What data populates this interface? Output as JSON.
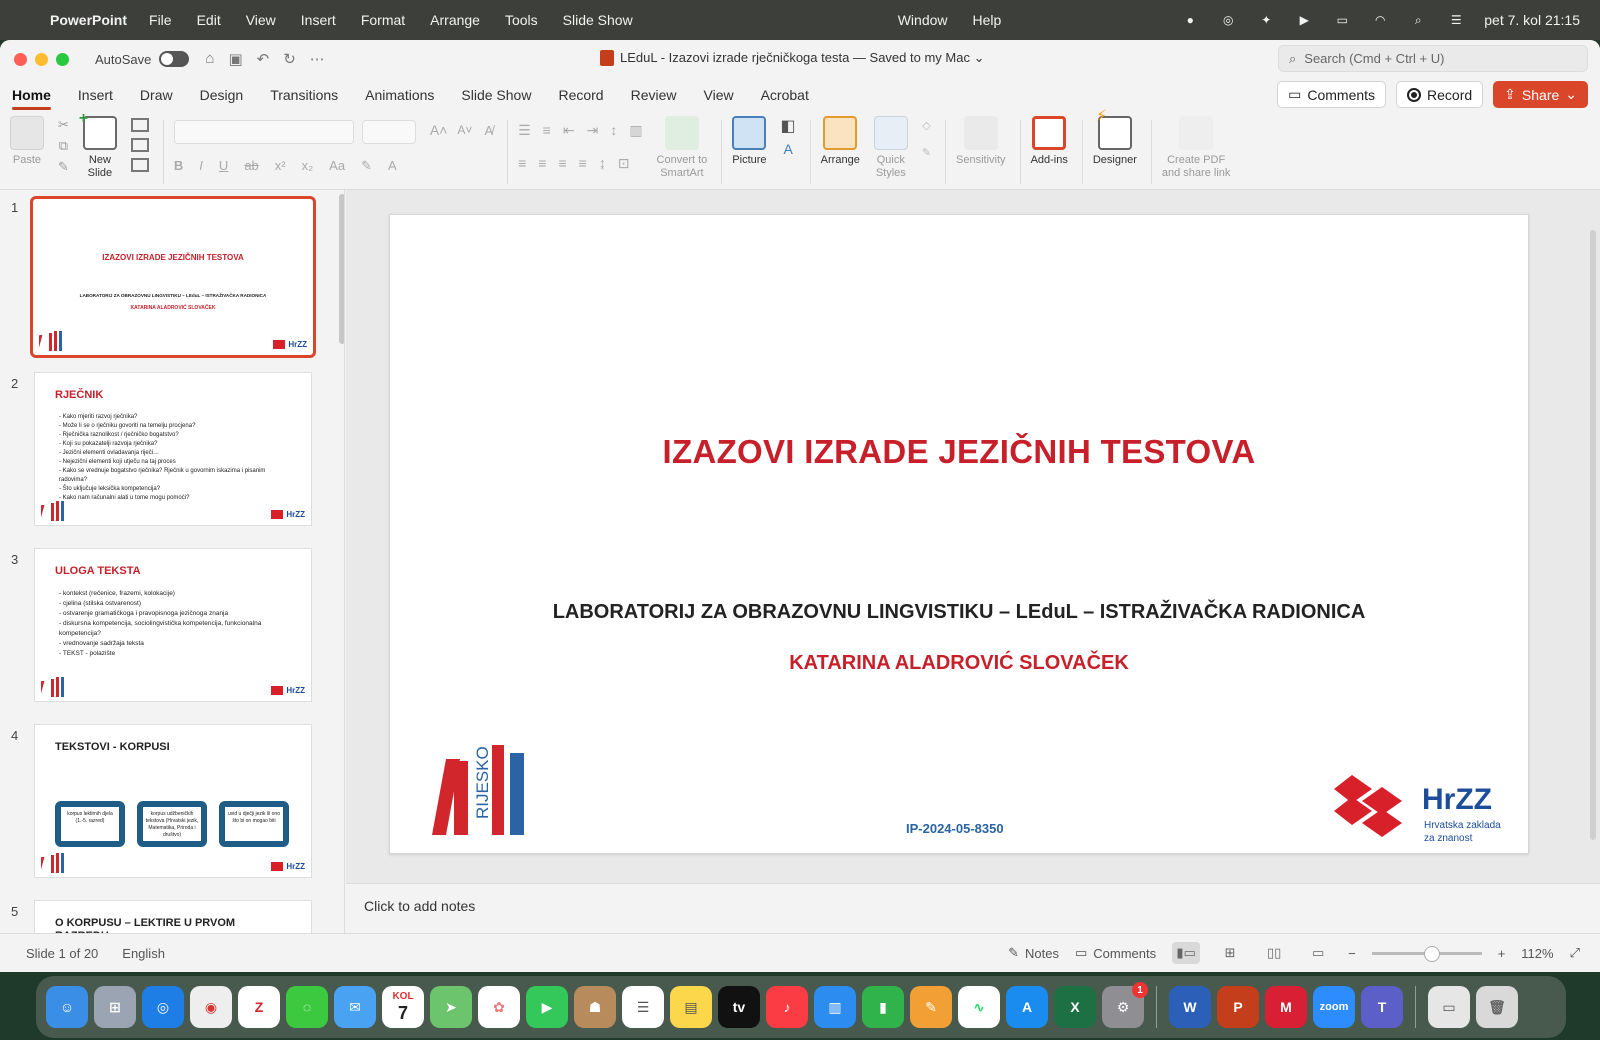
{
  "menubar": {
    "app_name": "PowerPoint",
    "items": [
      "File",
      "Edit",
      "View",
      "Insert",
      "Format",
      "Arrange",
      "Tools",
      "Slide Show"
    ],
    "items_mid": [
      "Window",
      "Help"
    ],
    "clock": "pet 7. kol  21:15"
  },
  "window": {
    "autosave_label": "AutoSave",
    "doc_title": "LEduL - Izazovi izrade rječničkoga testa — Saved to my Mac ⌄",
    "search_placeholder": "Search (Cmd + Ctrl + U)"
  },
  "tabs": [
    "Home",
    "Insert",
    "Draw",
    "Design",
    "Transitions",
    "Animations",
    "Slide Show",
    "Record",
    "Review",
    "View",
    "Acrobat"
  ],
  "tab_actions": {
    "comments": "Comments",
    "record": "Record",
    "share": "Share"
  },
  "ribbon": {
    "paste": "Paste",
    "new_slide_1": "New",
    "new_slide_2": "Slide",
    "convert_1": "Convert to",
    "convert_2": "SmartArt",
    "picture": "Picture",
    "arrange": "Arrange",
    "quick_styles_1": "Quick",
    "quick_styles_2": "Styles",
    "sensitivity": "Sensitivity",
    "addins": "Add-ins",
    "designer": "Designer",
    "pdf_1": "Create PDF",
    "pdf_2": "and share link"
  },
  "thumbnails": [
    {
      "num": "1",
      "title": "IZAZOVI IZRADE JEZIČNIH TESTOVA",
      "sub": "LABORATORIJ ZA OBRAZOVNU LINGVISTIKU – LEduL – ISTRAŽIVAČKA RADIONICA",
      "author": "KATARINA ALADROVIĆ SLOVAČEK"
    },
    {
      "num": "2",
      "title": "RJEČNIK",
      "bullets": [
        "Kako mjeriti razvoj rječnika?",
        "Može li se o rječniku govoriti na temelju procjena?",
        "Rječnička raznolikost / rječničko bogatstvo?",
        "Koji su pokazatelji razvoja rječnika?",
        "Jezični elementi ovladavanja riječi…",
        "Nejezični elementi koji utječu na taj proces",
        "Kako se vrednuje bogatstvo rječnika? Rječnik u govornim iskazima i pisanim radovima?",
        "Što uključuje leksička kompetencija?",
        "Kako nam računalni alati u tome mogu pomoći?"
      ]
    },
    {
      "num": "3",
      "title": "ULOGA TEKSTA",
      "bullets": [
        "kontekst (rečenice, frazemi, kolokacije)",
        "cjelina (stilska ostvarenost)",
        "ostvarenje gramatičkoga i pravopisnoga jezičnoga znanja",
        "diskursna kompetencija, sociolingvistička kompetencija, funkcionalna kompetencija?",
        "vrednovanje sadržaja teksta",
        "TEKST - polazište"
      ]
    },
    {
      "num": "4",
      "title": "TEKSTOVI - KORPUSI",
      "boxes": [
        "korpus lektirnih djela (1.-5. razred)",
        "korpus udžbeničkih tekstova (Hrvatski jezik, Matematika, Priroda i društvo)",
        "uvid u dječji jezik ili ono što bi on mogao biti"
      ]
    },
    {
      "num": "5",
      "title": "O KORPUSU – LEKTIRE U PRVOM RAZREDU"
    }
  ],
  "slide": {
    "title": "IZAZOVI IZRADE JEZIČNIH TESTOVA",
    "subtitle": "LABORATORIJ ZA OBRAZOVNU LINGVISTIKU – LEduL – ISTRAŽIVAČKA RADIONICA",
    "author": "KATARINA ALADROVIĆ SLOVAČEK",
    "project_code": "IP-2024-05-8350",
    "logo_left_text": "RIJESKO",
    "logo_right_name": "HrZZ",
    "logo_right_line1": "Hrvatska zaklada",
    "logo_right_line2": "za znanost"
  },
  "notes_placeholder": "Click to add notes",
  "status": {
    "slide_counter": "Slide 1 of 20",
    "language": "English",
    "notes": "Notes",
    "comments": "Comments",
    "zoom": "112%"
  },
  "colors": {
    "accent": "#c43e1c",
    "slide_red": "#c8202a",
    "hrzz_blue": "#1b4d9a"
  },
  "dock_icons": [
    "finder-icon",
    "launchpad-icon",
    "safari-icon",
    "chrome-icon",
    "zotero-icon",
    "messages-icon",
    "mail-icon",
    "calendar-icon",
    "maps-icon",
    "photos-icon",
    "facetime-icon",
    "contacts-icon",
    "reminders-icon",
    "notes-icon",
    "appletv-icon",
    "music-icon",
    "keynote-icon",
    "numbers-icon",
    "pages-icon",
    "freeform-icon",
    "appstore-icon",
    "excel-icon",
    "settings-icon",
    "word-icon",
    "powerpoint-icon",
    "mendeley-icon",
    "zoom-icon",
    "teams-icon",
    "preview-icon",
    "trash-icon"
  ],
  "dock_labels": {
    "calendar_month": "KOL",
    "calendar_day": "7",
    "zotero": "Z",
    "appletv": "tv",
    "zoom": "zoom",
    "settings_badge": "1"
  }
}
